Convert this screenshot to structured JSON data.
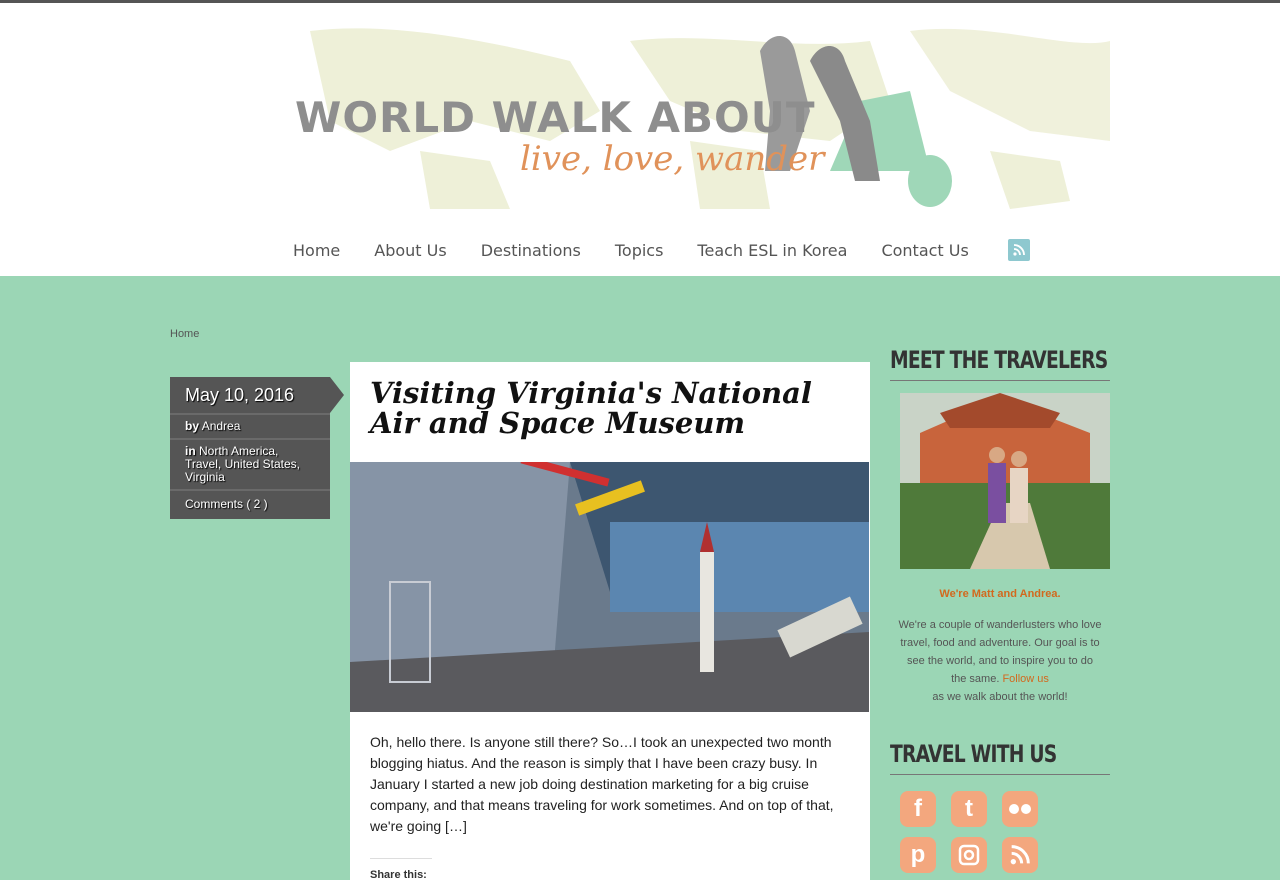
{
  "header": {
    "logo_main": "WORLD WALK ABOUT",
    "logo_tagline": "live, love, wander"
  },
  "nav": {
    "items": [
      "Home",
      "About Us",
      "Destinations",
      "Topics",
      "Teach ESL in Korea",
      "Contact Us"
    ]
  },
  "breadcrumb": "Home",
  "post": {
    "date": "May 10, 2016",
    "by_label": "by",
    "author": "Andrea",
    "in_label": "in",
    "categories": [
      "North America",
      "Travel",
      "United States",
      "Virginia"
    ],
    "comments": "Comments ( 2 )",
    "title": "Visiting Virginia's National Air and Space Museum",
    "excerpt": "Oh, hello there. Is anyone still there? So…I took an unexpected two month blogging hiatus. And the reason is simply that I have been crazy busy. In January I started a new job doing destination marketing for a big cruise company, and that means traveling for work sometimes. And on top of that, we're going […]",
    "share_label": "Share this:"
  },
  "sidebar": {
    "meet_heading": "MEET THE TRAVELERS",
    "names": "We're Matt and Andrea.",
    "bio": "We're a couple of wanderlusters who love travel, food and adventure. Our goal is to see the world, and to inspire you to do the same.",
    "follow_link": "Follow us",
    "bio_end": "as we walk about the world!",
    "travel_heading": "TRAVEL WITH US",
    "social": [
      "facebook-icon",
      "twitter-icon",
      "flickr-icon",
      "pinterest-icon",
      "instagram-icon",
      "rss-icon"
    ]
  },
  "colors": {
    "background": "#9bd6b5",
    "accent": "#d2691e",
    "social": "#f3a77e",
    "meta_box": "#555555"
  }
}
